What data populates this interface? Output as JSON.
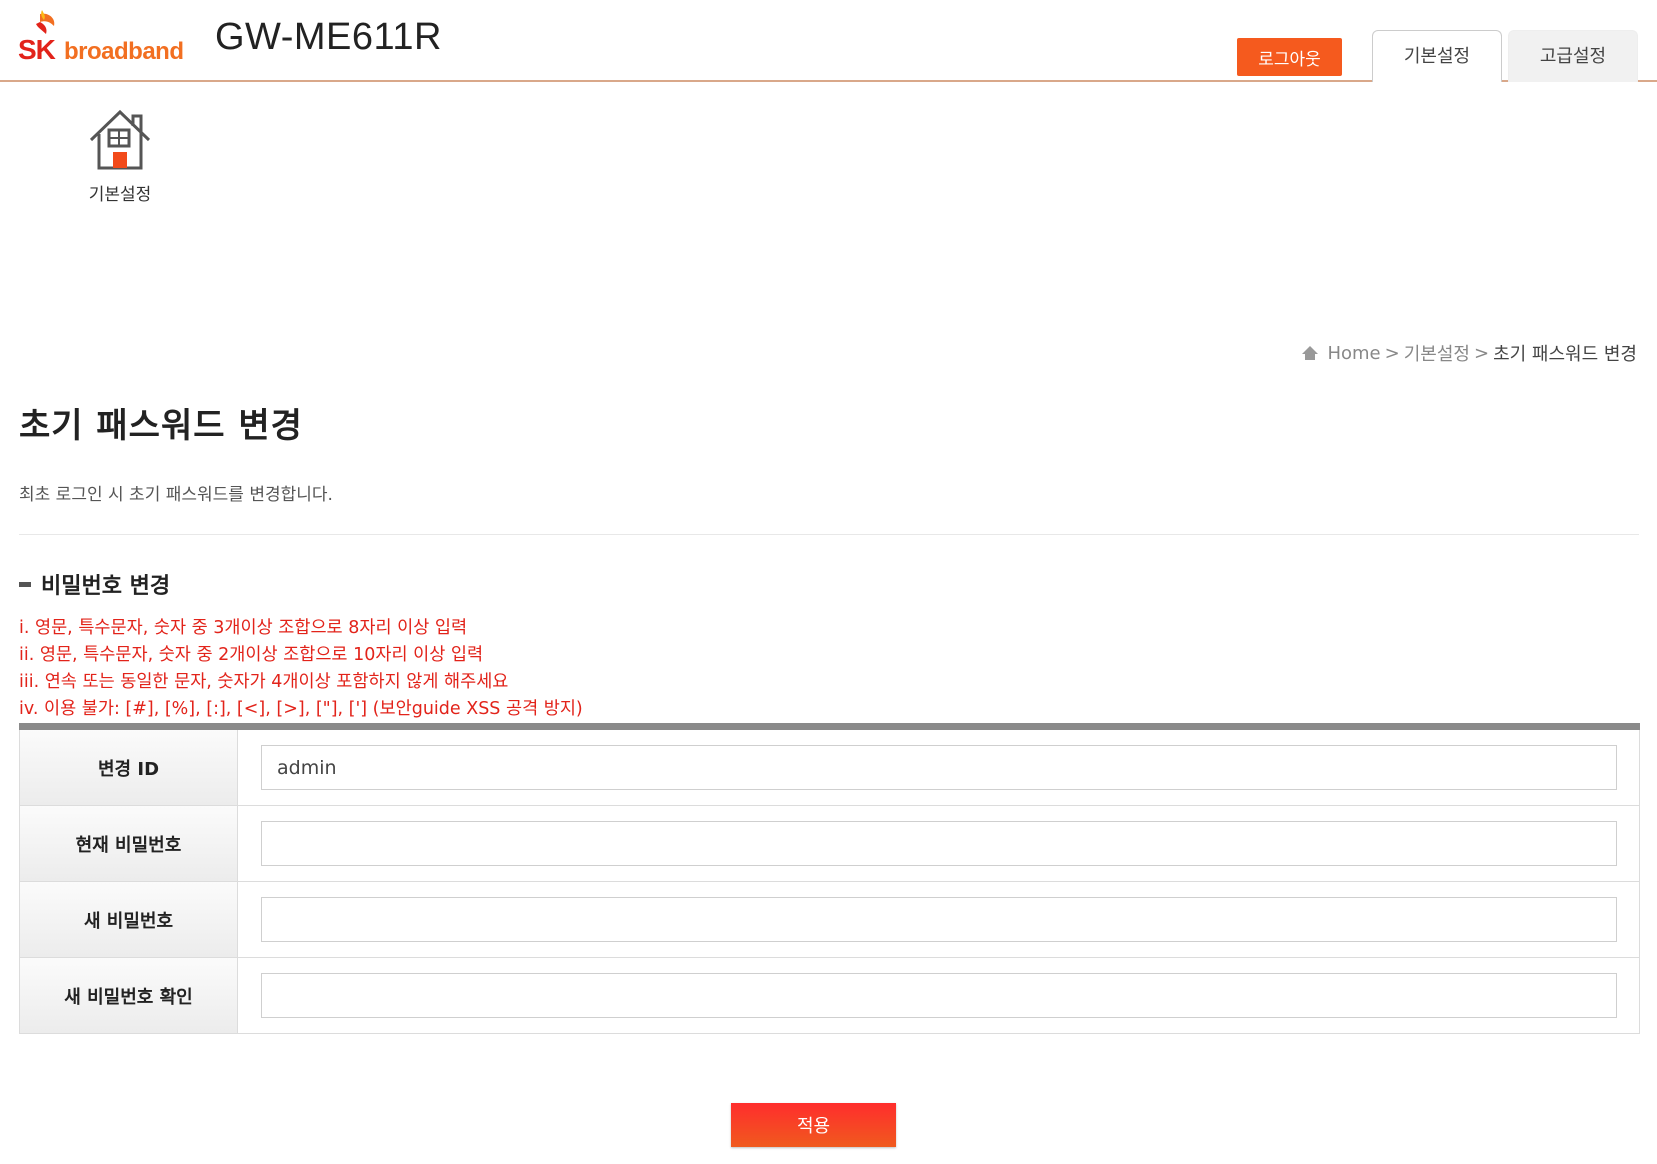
{
  "header": {
    "logo_sk": "SK",
    "logo_broadband": "broadband",
    "model": "GW-ME611R",
    "logout_label": "로그아웃",
    "tabs": [
      {
        "label": "기본설정"
      },
      {
        "label": "고급설정"
      }
    ]
  },
  "menu": {
    "home_label": "기본설정"
  },
  "breadcrumb": {
    "home": "Home",
    "sep1": ">",
    "level1": "기본설정",
    "sep2": ">",
    "current": "초기 패스워드 변경"
  },
  "page": {
    "title": "초기 패스워드 변경",
    "description": "최초 로그인 시 초기 패스워드를 변경합니다."
  },
  "section": {
    "title": "비밀번호 변경",
    "rules": [
      "i. 영문, 특수문자, 숫자 중 3개이상 조합으로 8자리 이상 입력",
      "ii. 영문, 특수문자, 숫자 중 2개이상 조합으로 10자리 이상 입력",
      "iii. 연속 또는 동일한 문자, 숫자가 4개이상 포함하지 않게 해주세요",
      "iv. 이용 불가: [#], [%], [:], [<], [>], [\"], ['] (보안guide XSS 공격 방지)"
    ]
  },
  "form": {
    "rows": [
      {
        "label": "변경 ID",
        "value": "admin"
      },
      {
        "label": "현재 비밀번호",
        "value": ""
      },
      {
        "label": "새 비밀번호",
        "value": ""
      },
      {
        "label": "새 비밀번호 확인",
        "value": ""
      }
    ]
  },
  "apply_label": "적용",
  "colors": {
    "accent_orange": "#f55a1e",
    "rule_red": "#e2231a",
    "header_border": "#d9a88a"
  },
  "icons": {
    "home_menu": "house-icon",
    "breadcrumb_home": "home-icon"
  }
}
